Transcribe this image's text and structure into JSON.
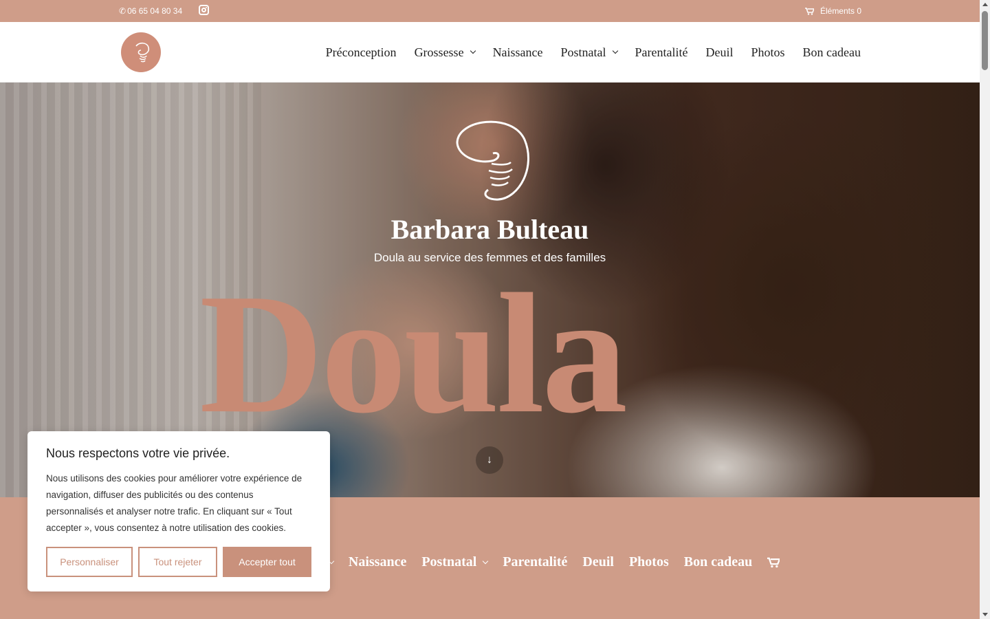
{
  "topbar": {
    "phone": "06 65 04 80 34",
    "cart_label": "Éléments 0"
  },
  "nav": {
    "items": [
      {
        "label": "Préconception",
        "dropdown": false
      },
      {
        "label": "Grossesse",
        "dropdown": true
      },
      {
        "label": "Naissance",
        "dropdown": false
      },
      {
        "label": "Postnatal",
        "dropdown": true
      },
      {
        "label": "Parentalité",
        "dropdown": false
      },
      {
        "label": "Deuil",
        "dropdown": false
      },
      {
        "label": "Photos",
        "dropdown": false
      },
      {
        "label": "Bon cadeau",
        "dropdown": false
      }
    ]
  },
  "hero": {
    "title": "Barbara Bulteau",
    "subtitle": "Doula au service des femmes et des familles",
    "big_word": "Doula",
    "scroll_arrow": "↓"
  },
  "nav2": {
    "partial_label": "e",
    "items": [
      "Naissance",
      "Postnatal",
      "Parentalité",
      "Deuil",
      "Photos",
      "Bon cadeau"
    ]
  },
  "cookie": {
    "title": "Nous respectons votre vie privée.",
    "text": "Nous utilisons des cookies pour améliorer votre expérience de navigation, diffuser des publicités ou des contenus personnalisés et analyser notre trafic. En cliquant sur « Tout accepter », vous consentez à notre utilisation des cookies.",
    "customize_label": "Personnaliser",
    "reject_label": "Tout rejeter",
    "accept_label": "Accepter tout"
  },
  "colors": {
    "brand": "#cf9d89",
    "accent": "#c88a74"
  }
}
